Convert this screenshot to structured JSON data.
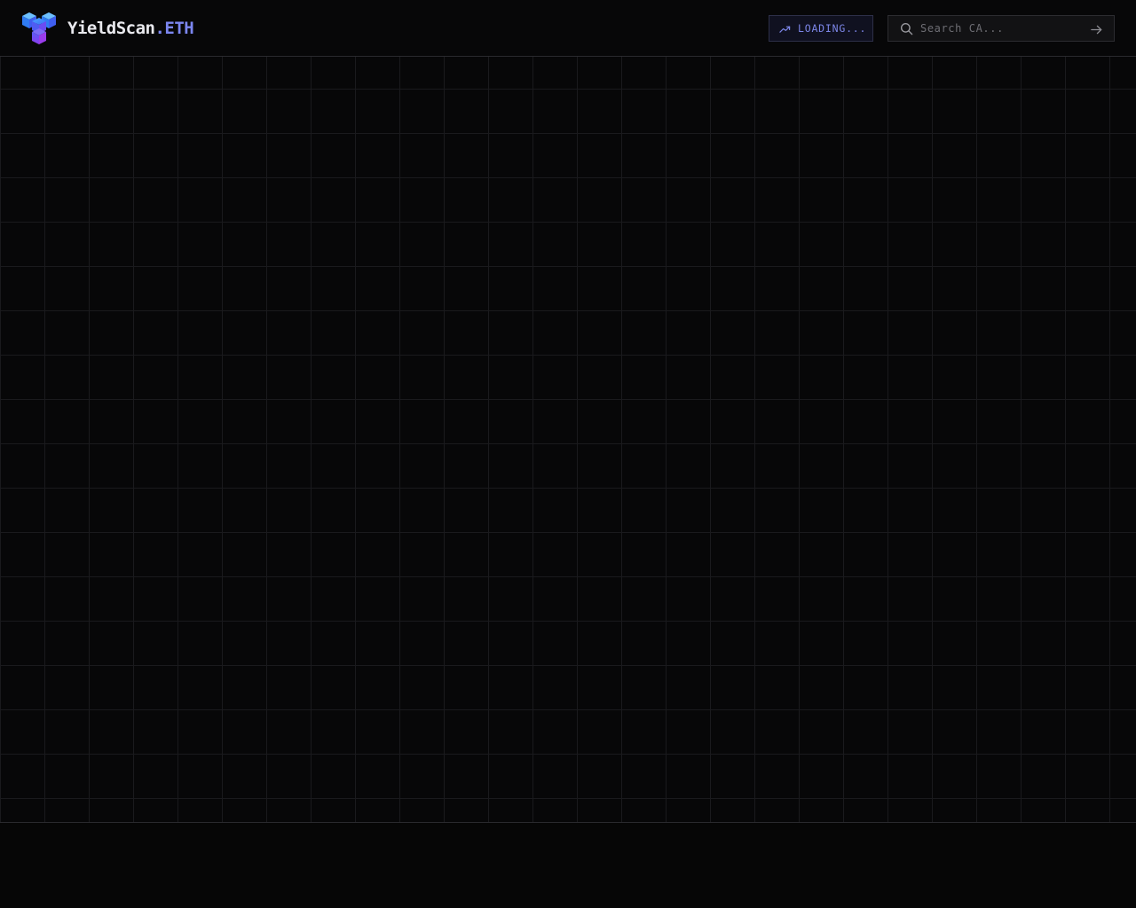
{
  "header": {
    "brand": {
      "name": "YieldScan",
      "tld": ".ETH"
    },
    "logo_icon": "cube-stack-icon",
    "trending_button": {
      "label": "LOADING...",
      "icon": "trending-up-icon"
    },
    "search": {
      "placeholder": "Search CA...",
      "value": "",
      "icon": "search-icon",
      "submit_icon": "arrow-right-icon"
    }
  },
  "colors": {
    "background": "#060606",
    "accent": "#7b86f0",
    "logo_blue": "#3b82f6",
    "logo_purple": "#8b5cf6"
  }
}
